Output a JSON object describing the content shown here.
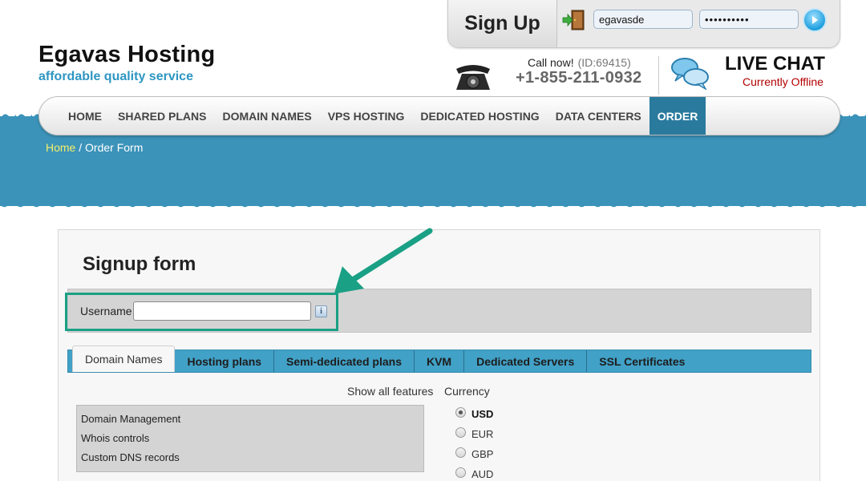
{
  "brand": {
    "title": "Egavas Hosting",
    "tagline": "affordable quality service"
  },
  "signup_bar": {
    "label": "Sign Up",
    "username_value": "egavasde",
    "password_value": "••••••••••"
  },
  "contact": {
    "call_now": "Call now!",
    "id": "(ID:69415)",
    "phone": "+1-855-211-0932",
    "live_chat": "LIVE CHAT",
    "chat_status": "Currently Offline"
  },
  "nav": {
    "items": [
      "HOME",
      "SHARED PLANS",
      "DOMAIN NAMES",
      "VPS HOSTING",
      "DEDICATED HOSTING",
      "DATA CENTERS",
      "ORDER"
    ],
    "active": "ORDER"
  },
  "breadcrumb": {
    "home": "Home",
    "separator": " / ",
    "current": "Order Form"
  },
  "form": {
    "title": "Signup form",
    "username_label": "Username",
    "username_value": "",
    "info_glyph": "i"
  },
  "tabs": {
    "items": [
      "Domain Names",
      "Hosting plans",
      "Semi-dedicated plans",
      "KVM",
      "Dedicated Servers",
      "SSL Certificates"
    ],
    "active": "Domain Names"
  },
  "features": {
    "show_all": "Show all features",
    "items": [
      "Domain Management",
      "Whois controls",
      "Custom DNS records"
    ]
  },
  "currency": {
    "label": "Currency",
    "options": [
      "USD",
      "EUR",
      "GBP",
      "AUD"
    ],
    "selected": "USD"
  },
  "colors": {
    "accent_blue": "#3b93b9",
    "nav_active": "#2a7a9e",
    "tab_bar": "#41a1c7",
    "highlight": "#1aa085",
    "chat_offline": "#b30000"
  }
}
